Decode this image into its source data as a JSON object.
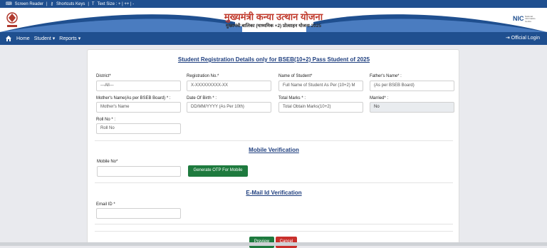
{
  "topbar": {
    "screen_reader": "Screen Reader",
    "shortcut_keys": "Shortcuts Keys",
    "text_size": "Text Size : + | ++ | -"
  },
  "header": {
    "title": "मुख्यमंत्री कन्या उत्थान योजना",
    "subtitle": "मुख्यमंत्री बालिका (माध्यमिक +2) प्रोत्साहन योजना 2025",
    "nic_label": "NIC",
    "nic_sub": "National Informatics Centre"
  },
  "nav": {
    "home": "Home",
    "student": "Student ▾",
    "reports": "Reports ▾",
    "official_login": "Official Login"
  },
  "form": {
    "title": "Student Registration Details only for BSEB(10+2) Pass Student of 2025",
    "district_label": "District*",
    "district_value": "---All---",
    "regno_label": "Registration No.*",
    "regno_placeholder": "X-XXXXXXXXX-XX",
    "name_label": "Name of Student*",
    "name_placeholder": "Full Name of Student As Per (10+2) M",
    "father_label": "Father's Name* :",
    "father_placeholder": "(As per BSEB Board)",
    "mother_label": "Mother's Name(As per BSEB Board) * :",
    "mother_placeholder": "Mother's Name",
    "dob_label": "Date Of Birth * :",
    "dob_placeholder": "DD/MM/YYYY (As Per 10th)",
    "marks_label": "Total Marks * :",
    "marks_placeholder": "Total Obtain Marks(10+2)",
    "married_label": "Married* :",
    "married_value": "No",
    "roll_label": "Roll No * :",
    "roll_placeholder": "Roll No"
  },
  "mobile": {
    "title": "Mobile Verification",
    "label": "Mobile No*",
    "otp_button": "Generate OTP For Mobile"
  },
  "email": {
    "title": "E-Mail Id Verification",
    "label": "Email ID *"
  },
  "actions": {
    "preview": "Preview",
    "cancel": "Cancel"
  },
  "colors": {
    "nav_blue": "#1f4f8f",
    "title_red": "#c0392b",
    "button_green": "#1e7a3e",
    "button_red": "#c9302c"
  }
}
